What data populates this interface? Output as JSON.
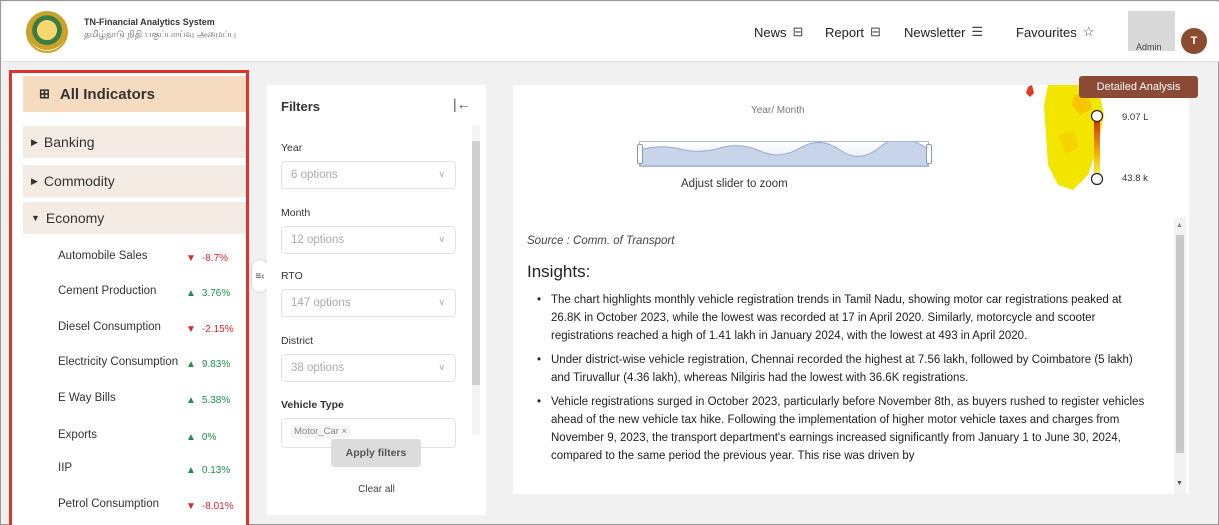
{
  "header": {
    "app_title": "TN-Financial Analytics System",
    "app_subtitle": "தமிழ்நாடு நிதி பகுப்பாய்வு அமைப்பு",
    "nav": [
      {
        "label": "News",
        "icon": "news-icon"
      },
      {
        "label": "Report",
        "icon": "report-icon"
      },
      {
        "label": "Newsletter",
        "icon": "newsletter-icon"
      },
      {
        "label": "Favourites",
        "icon": "star-icon"
      }
    ],
    "user_label": "Admin",
    "avatar_initial": "T"
  },
  "sidebar": {
    "title": "All Indicators",
    "categories": [
      {
        "label": "Banking",
        "expanded": false
      },
      {
        "label": "Commodity",
        "expanded": false
      },
      {
        "label": "Economy",
        "expanded": true
      }
    ],
    "indicators": [
      {
        "name": "Automobile Sales",
        "arrow": "▼",
        "value": "-8.7%",
        "trend": "down"
      },
      {
        "name": "Cement Production",
        "arrow": "▲",
        "value": "3.76%",
        "trend": "up"
      },
      {
        "name": "Diesel Consumption",
        "arrow": "▼",
        "value": "-2.15%",
        "trend": "down"
      },
      {
        "name": "Electricity Consumption",
        "arrow": "▲",
        "value": "9.83%",
        "trend": "up"
      },
      {
        "name": "E Way Bills",
        "arrow": "▲",
        "value": "5.38%",
        "trend": "up"
      },
      {
        "name": "Exports",
        "arrow": "▲",
        "value": "0%",
        "trend": "up"
      },
      {
        "name": "IIP",
        "arrow": "▲",
        "value": "0.13%",
        "trend": "up"
      },
      {
        "name": "Petrol Consumption",
        "arrow": "▼",
        "value": "-8.01%",
        "trend": "down"
      }
    ]
  },
  "filters": {
    "title": "Filters",
    "fields": [
      {
        "label": "Year",
        "value": "6 options"
      },
      {
        "label": "Month",
        "value": "12 options"
      },
      {
        "label": "RTO",
        "value": "147 options"
      },
      {
        "label": "District",
        "value": "38 options"
      }
    ],
    "vehicle_type": {
      "label": "Vehicle Type",
      "tag": "Motor_Car"
    },
    "apply_label": "Apply filters",
    "clear_label": "Clear all"
  },
  "chart": {
    "axis_label": "Year/ Month",
    "zoom_hint": "Adjust slider to zoom",
    "legend_max": "9.07 L",
    "legend_min": "43.8 k"
  },
  "detailed_analysis_label": "Detailed Analysis",
  "source": "Source : Comm. of Transport",
  "insights_title": "Insights:",
  "insights": [
    "The chart highlights monthly vehicle registration trends in Tamil Nadu, showing motor car registrations peaked at 26.8K in October 2023, while the lowest was recorded at 17 in April 2020. Similarly, motorcycle and scooter registrations reached a high of 1.41 lakh in January 2024, with the lowest at 493 in April 2020.",
    "Under district-wise vehicle registration, Chennai recorded the highest at 7.56 lakh, followed by Coimbatore (5 lakh) and Tiruvallur (4.36 lakh), whereas Nilgiris had the lowest with 36.6K registrations.",
    "Vehicle registrations surged in October 2023, particularly before November 8th, as buyers rushed to register vehicles ahead of the new vehicle tax hike. Following the implementation of higher motor vehicle taxes and charges from November 9, 2023, the transport department's earnings increased significantly from January 1 to June 30, 2024, compared to the same period the previous year. This rise was driven by"
  ],
  "colors": {
    "accent": "#8b4a35",
    "sidebar_highlight": "#f5dcc0",
    "category_bg": "#f4ece4",
    "up": "#1e8f4e",
    "down": "#d9262c",
    "selection_border": "#e0342a"
  }
}
